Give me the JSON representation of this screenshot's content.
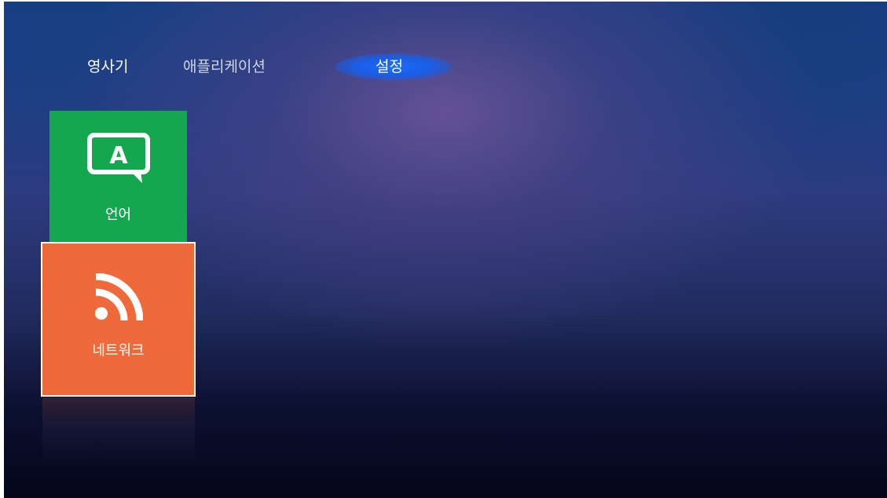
{
  "nav": {
    "tabs": [
      {
        "label": "영사기",
        "selected": false
      },
      {
        "label": "애플리케이션",
        "selected": false
      },
      {
        "label": "설정",
        "selected": true
      }
    ],
    "selected_highlight_color": "#1e6cf5"
  },
  "tiles": [
    {
      "label": "언어",
      "icon": "language-speech-bubble-icon",
      "color": "#13a84f",
      "focused": false
    },
    {
      "label": "네트워크",
      "icon": "rss-network-icon",
      "color": "#ee6a3a",
      "focused": true
    }
  ],
  "icons": {
    "language_glyph": "A"
  }
}
